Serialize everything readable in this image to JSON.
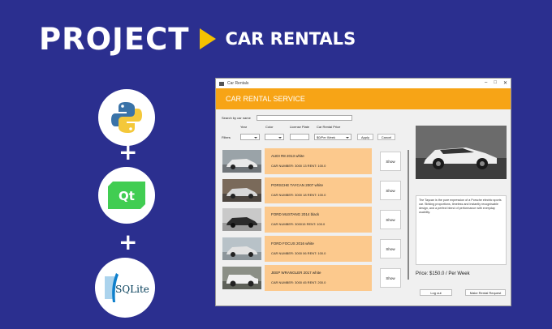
{
  "banner": {
    "title_big": "PROJECT",
    "title_small": "CAR RENTALS"
  },
  "tech": [
    {
      "name": "python-logo"
    },
    {
      "name": "qt-logo",
      "text": "Qt"
    },
    {
      "name": "sqlite-logo",
      "text": "SQLite"
    }
  ],
  "plus": "+",
  "window": {
    "title": "Car Rentals",
    "controls": [
      "–",
      "□",
      "✕"
    ],
    "header": "CAR RENTAL SERVICE",
    "search_label": "Search by car name",
    "search_value": "",
    "filter_label": "Filters",
    "columns": {
      "year": "Year",
      "color": "Color",
      "plate": "License Plate",
      "price": "Car Rental Price"
    },
    "price_value": "$0/Per Week",
    "apply": "Apply",
    "cancel": "Cancel",
    "cars": [
      {
        "name": "AUDI R8 2013 white",
        "info": "CAR NUMBER: 3000 13 RENT: 100.0",
        "show": "Show",
        "color": "#e9e9e9"
      },
      {
        "name": "PORSCHE TAYCAN 2007 white",
        "info": "CAR NUMBER: 3000 18 RENT: 100.0",
        "show": "Show",
        "color": "#d8d8d8"
      },
      {
        "name": "FORD MUSTANG 2014 black",
        "info": "CAR NUMBER: 300015 RENT: 100.0",
        "show": "Show",
        "color": "#2b2b2b"
      },
      {
        "name": "FORD FOCUS 2016 white",
        "info": "CAR NUMBER: 3000 06 RENT: 100.0",
        "show": "Show",
        "color": "#e2e2e2"
      },
      {
        "name": "JEEP WRANGLER 2017 white",
        "info": "CAR NUMBER: 3000 45 RENT: 200.0",
        "show": "Show",
        "color": "#f0f0f0"
      }
    ],
    "description": "The Taycan is the pure expression of a Porsche electric sports car. Striking proportions, timeless and instantly recognisable design, and a perfect blend of performance with everyday usability.",
    "price_text": "Price: $150.0 / Per Week",
    "logout": "Log out",
    "make_request": "Make Rental Request"
  }
}
